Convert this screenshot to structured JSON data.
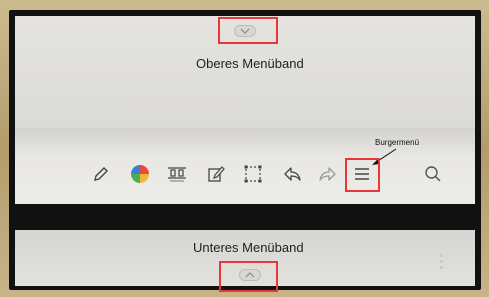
{
  "captions": {
    "top": "Oberes Menüband",
    "bottom": "Unteres Menüband",
    "burger": "Burgermenü"
  },
  "colors": {
    "highlight": "#e8363a",
    "frame": "#c2ad7e",
    "bezel": "#111111"
  },
  "toolbar": {
    "tools": [
      "pen-icon",
      "color-wheel-icon",
      "layout-icon",
      "edit-page-icon",
      "selection-icon",
      "undo-icon",
      "redo-icon",
      "burger-menu-icon",
      "search-icon"
    ]
  }
}
